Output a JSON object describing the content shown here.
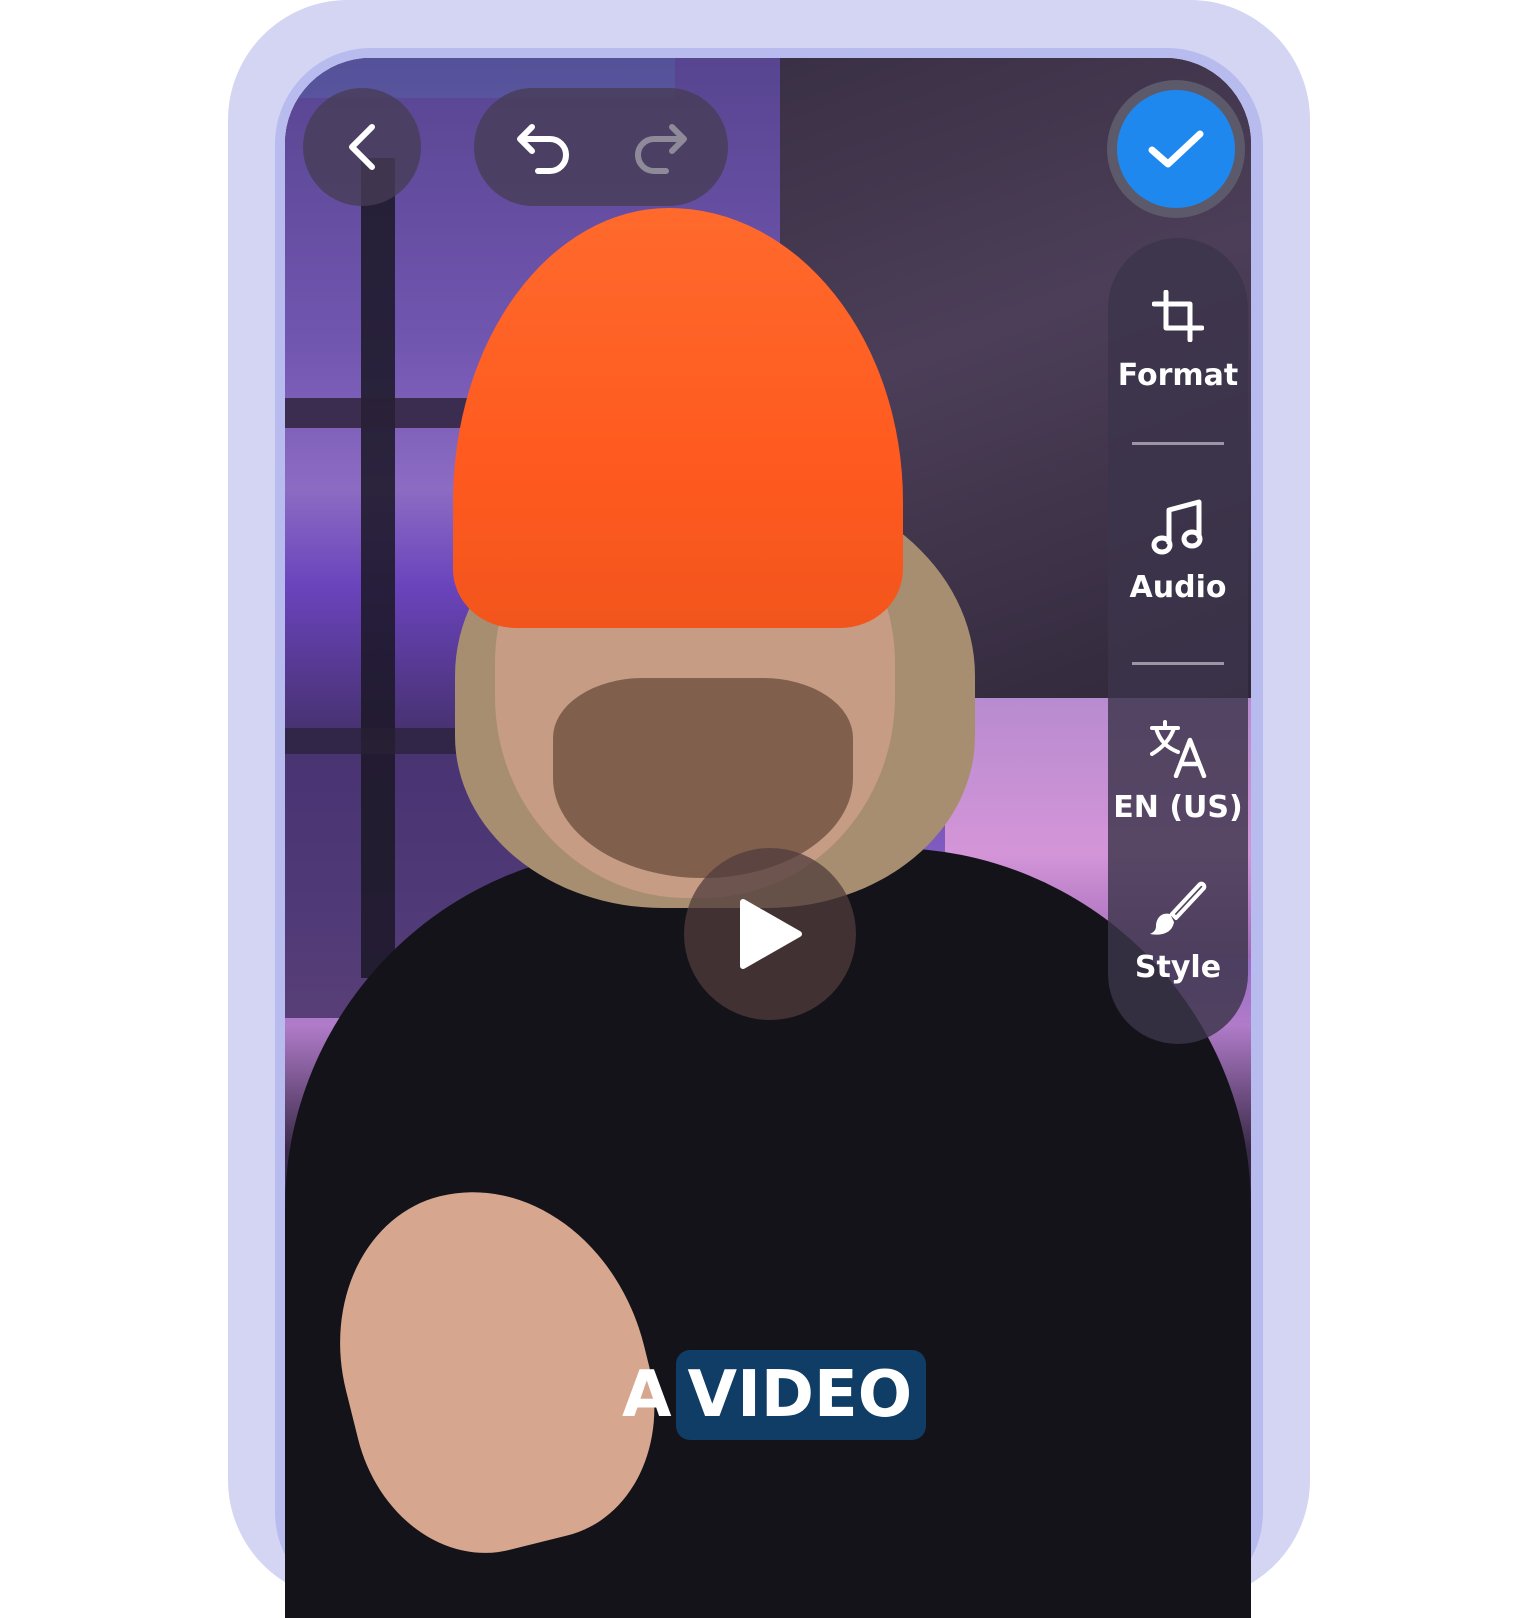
{
  "toolbar": {
    "format_label": "Format",
    "audio_label": "Audio",
    "language_label": "EN (US)",
    "style_label": "Style"
  },
  "caption": {
    "word1": "A",
    "word2": "VIDEO"
  },
  "colors": {
    "accent": "#1e88ee",
    "caption_highlight": "#0f3d66",
    "frame": "#d3d5f3"
  },
  "icons": {
    "back": "chevron-left-icon",
    "undo": "undo-icon",
    "redo": "redo-icon",
    "confirm": "check-icon",
    "format": "crop-icon",
    "audio": "music-note-icon",
    "language": "translate-icon",
    "style": "brush-icon",
    "play": "play-icon"
  },
  "state": {
    "redo_enabled": false
  }
}
